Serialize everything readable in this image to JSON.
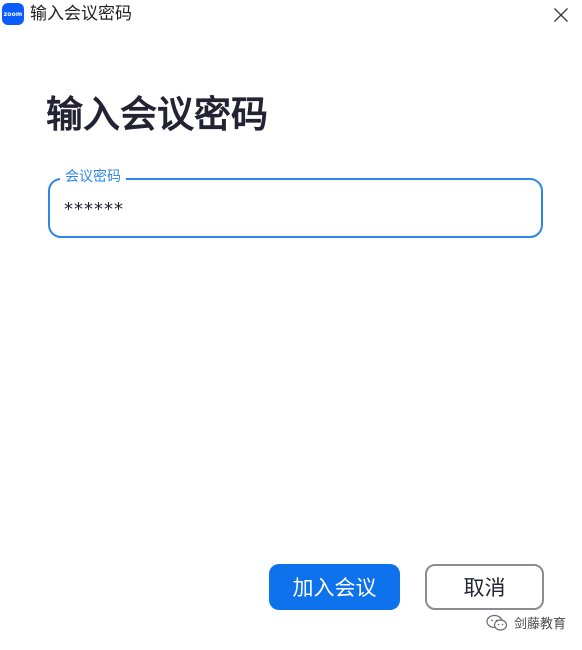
{
  "window": {
    "title": "输入会议密码",
    "logo_text": "zoom",
    "close_icon": "close-icon"
  },
  "dialog": {
    "heading": "输入会议密码",
    "password_field": {
      "label": "会议密码",
      "value": "******"
    }
  },
  "buttons": {
    "join_label": "加入会议",
    "cancel_label": "取消"
  },
  "watermark": {
    "text": "剑藤教育",
    "icon": "wechat-icon"
  },
  "colors": {
    "brand_blue": "#0b5cff",
    "primary_button": "#0e72ed",
    "field_border": "#2f86e8",
    "cancel_border": "#8b8b92"
  }
}
